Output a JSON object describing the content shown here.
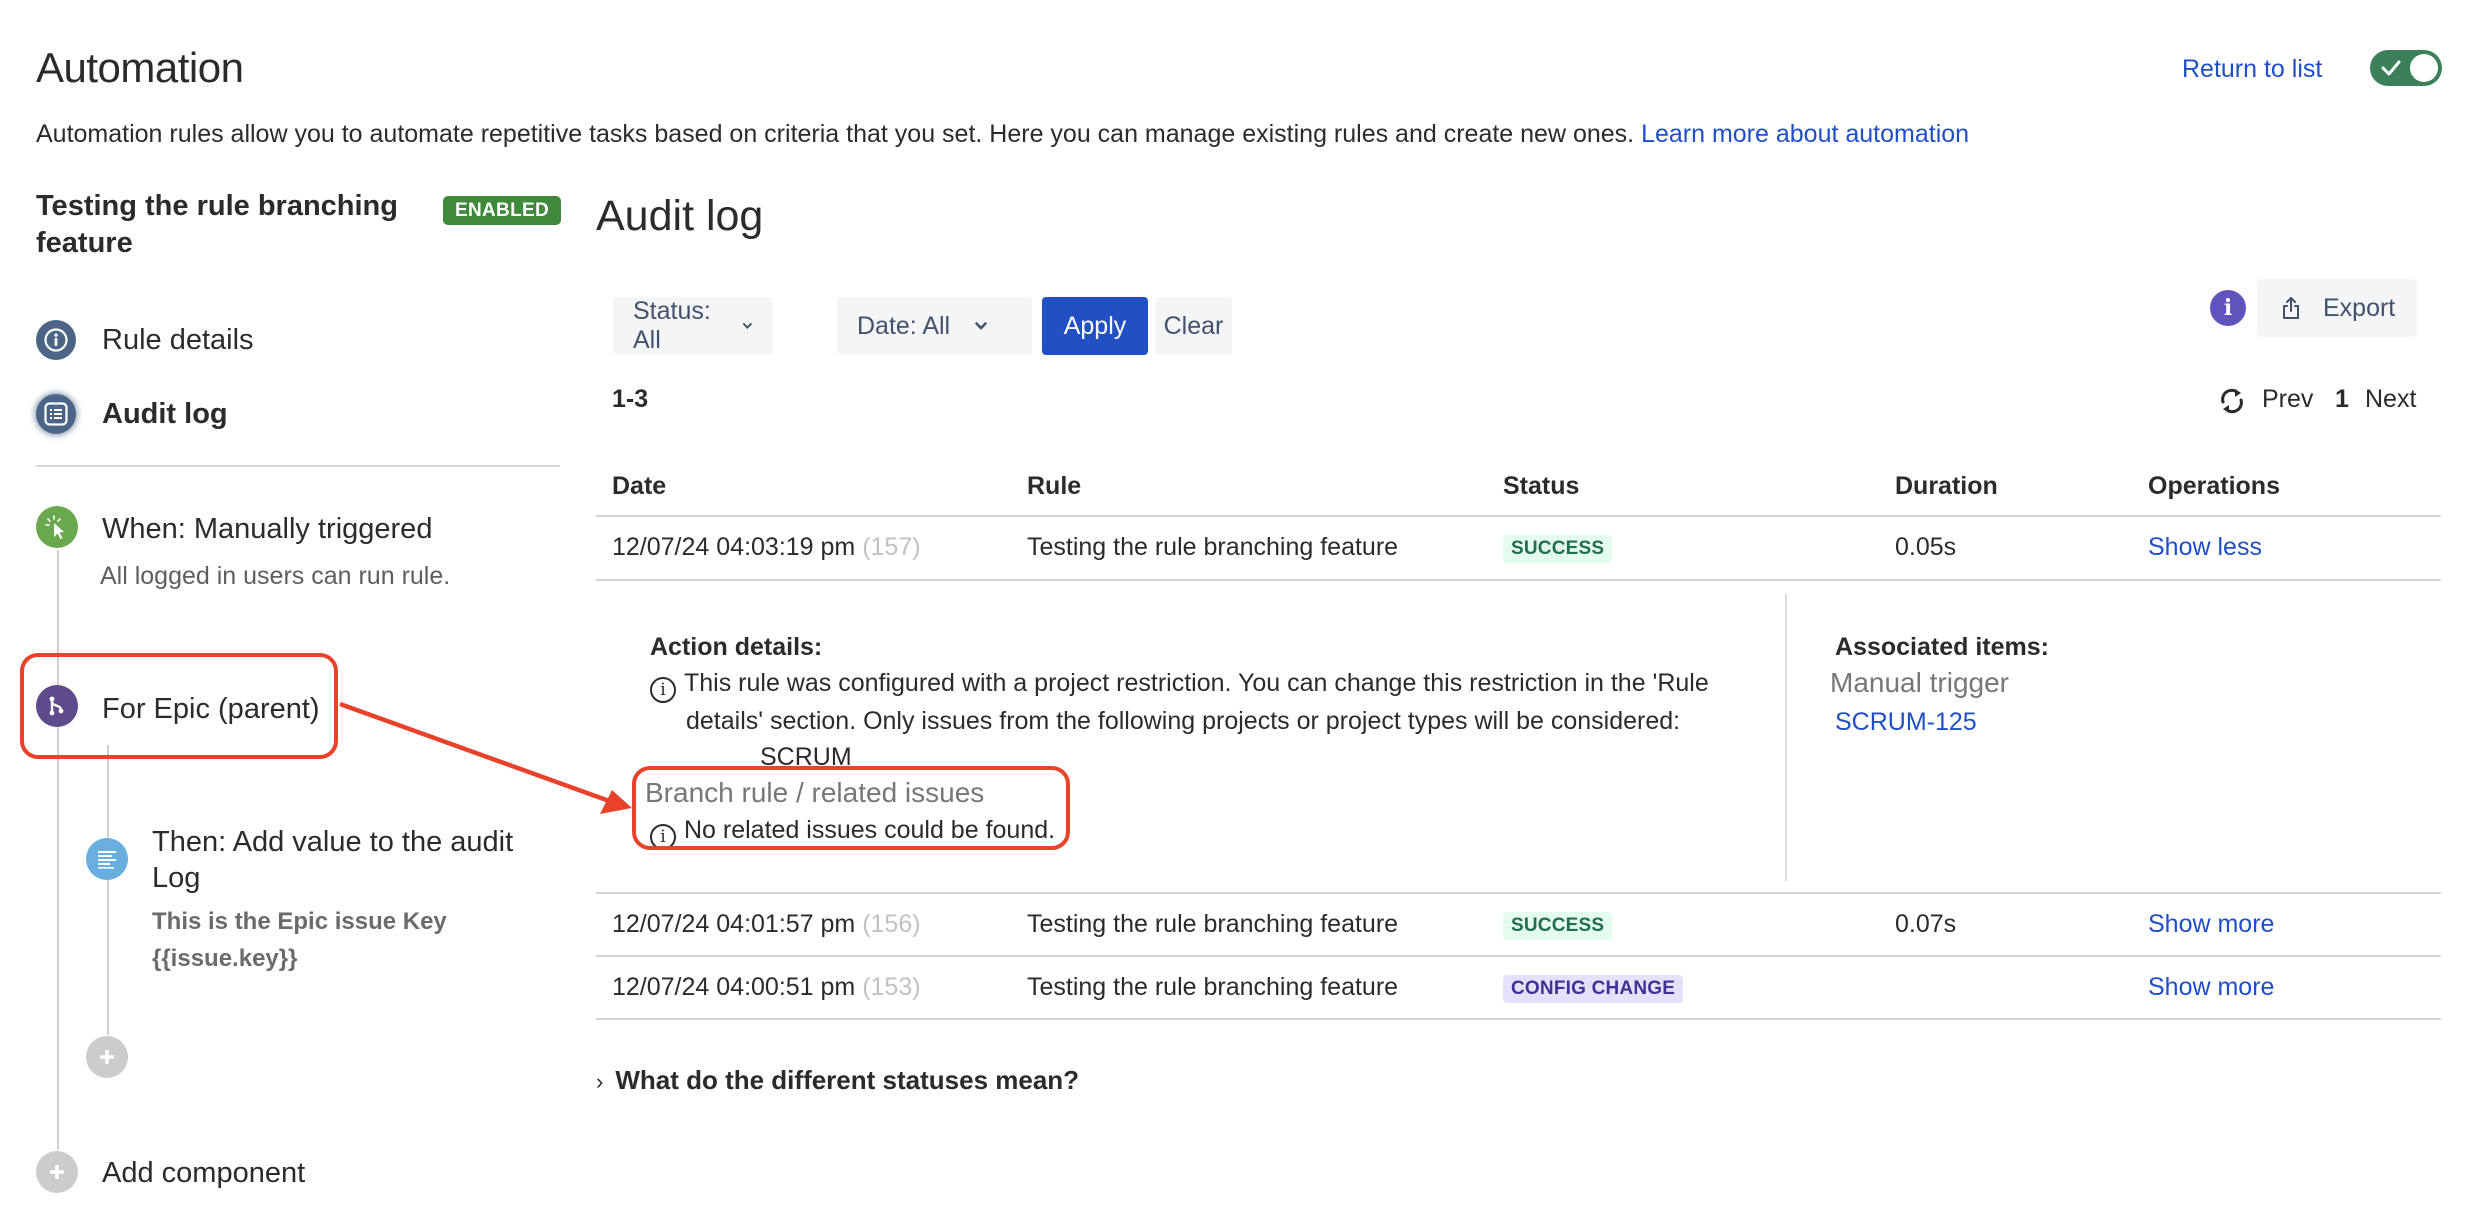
{
  "header": {
    "title": "Automation",
    "description": "Automation rules allow you to automate repetitive tasks based on criteria that you set. Here you can manage existing rules and create new ones.",
    "learn_more_link": "Learn more about automation",
    "return_link": "Return to list",
    "rule_enabled_toggle": true
  },
  "sidebar": {
    "rule_title": "Testing the rule branching feature",
    "rule_status_badge": "ENABLED",
    "nav": [
      {
        "label": "Rule details",
        "icon": "info-icon",
        "active": false
      },
      {
        "label": "Audit log",
        "icon": "list-icon",
        "active": true
      }
    ],
    "components": {
      "trigger": {
        "label": "When: Manually triggered",
        "sublabel": "All logged in users can run rule.",
        "icon": "cursor-click-icon",
        "color": "#6aa84f"
      },
      "branch": {
        "label": "For Epic (parent)",
        "icon": "branch-icon",
        "color": "#5e4b8b"
      },
      "action": {
        "label": "Then: Add value to the audit Log",
        "detail_line1": "This is the Epic issue Key",
        "detail_line2": "{{issue.key}}",
        "icon": "log-icon",
        "color": "#6aaddf"
      },
      "add_component": "Add component"
    }
  },
  "main": {
    "title": "Audit log",
    "filters": {
      "status": "Status: All",
      "date": "Date: All",
      "apply": "Apply",
      "clear": "Clear"
    },
    "export_label": "Export",
    "range": "1-3",
    "pager": {
      "prev": "Prev",
      "page": "1",
      "next": "Next"
    },
    "columns": [
      "Date",
      "Rule",
      "Status",
      "Duration",
      "Operations"
    ],
    "rows": [
      {
        "date": "12/07/24 04:03:19 pm",
        "exec_id": "(157)",
        "rule": "Testing the rule branching feature",
        "status": "SUCCESS",
        "duration": "0.05s",
        "operation": "Show less"
      },
      {
        "date": "12/07/24 04:01:57 pm",
        "exec_id": "(156)",
        "rule": "Testing the rule branching feature",
        "status": "SUCCESS",
        "duration": "0.07s",
        "operation": "Show more"
      },
      {
        "date": "12/07/24 04:00:51 pm",
        "exec_id": "(153)",
        "rule": "Testing the rule branching feature",
        "status": "CONFIG CHANGE",
        "duration": "",
        "operation": "Show more"
      }
    ],
    "expanded": {
      "action_details_heading": "Action details:",
      "restriction_line1": "This rule was configured with a project restriction. You can change this restriction in the 'Rule",
      "restriction_line2": "details' section. Only issues from the following projects or project types will be considered:",
      "project": "SCRUM",
      "branch_heading": "Branch rule / related issues",
      "branch_message": "No related issues could be found.",
      "associated_heading": "Associated items:",
      "associated_trigger": "Manual trigger",
      "associated_issue": "SCRUM-125"
    },
    "statuses_help": "What do the different statuses mean?"
  },
  "annotation": {
    "color": "#e8432a"
  }
}
